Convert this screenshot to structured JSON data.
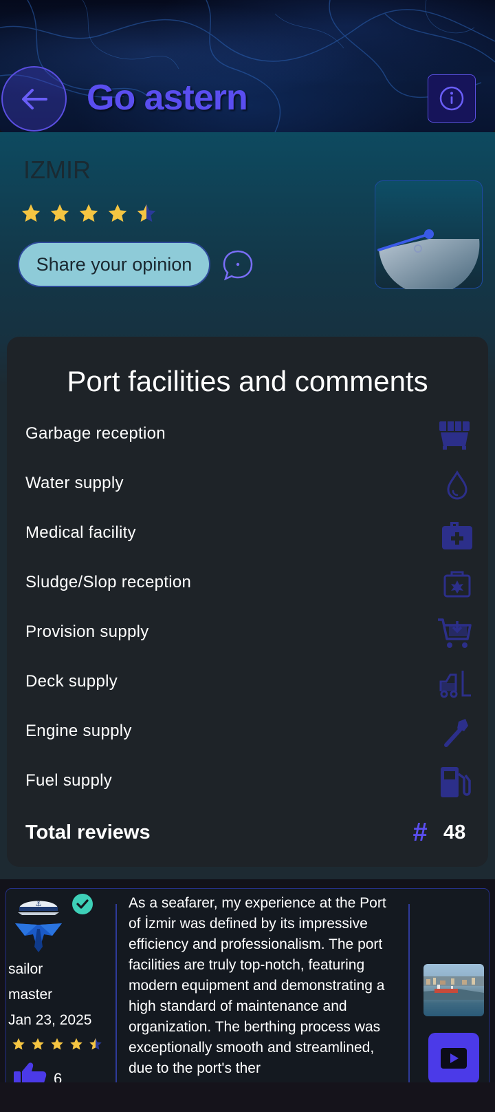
{
  "header": {
    "title": "Go astern",
    "back_icon": "arrow-left-icon",
    "info_icon": "info-circle-icon"
  },
  "port": {
    "name": "IZMIR",
    "rating": 4.5,
    "share_label": "Share your opinion",
    "chat_icon": "chat-bubble-icon",
    "gauge_icon": "gauge-icon"
  },
  "facilities": {
    "title": "Port facilities and comments",
    "items": [
      {
        "label": "Garbage reception",
        "icon": "dumpster-icon"
      },
      {
        "label": "Water supply",
        "icon": "water-drop-icon"
      },
      {
        "label": "Medical facility",
        "icon": "medical-kit-icon"
      },
      {
        "label": "Sludge/Slop reception",
        "icon": "oil-tank-icon"
      },
      {
        "label": "Provision supply",
        "icon": "cart-icon"
      },
      {
        "label": "Deck supply",
        "icon": "forklift-icon"
      },
      {
        "label": "Engine supply",
        "icon": "wrench-icon"
      },
      {
        "label": "Fuel supply",
        "icon": "fuel-pump-icon"
      }
    ],
    "total_label": "Total reviews",
    "total_symbol": "#",
    "total_count": "48"
  },
  "review": {
    "role": "sailor",
    "rank": "master",
    "date": "Jan 23, 2025",
    "rating": 4.5,
    "likes": "6",
    "text": "As a seafarer, my experience at the Port of İzmir was defined by its impressive efficiency and professionalism. The port facilities are truly top-notch, featuring modern equipment and demonstrating a high standard of maintenance and organization. The berthing process was exceptionally smooth and streamlined, due to the port's ther"
  },
  "colors": {
    "accent": "#5a4ef0",
    "star": "#f5c542",
    "share_bg": "#8ecbd8",
    "card_bg": "#1e2328"
  }
}
